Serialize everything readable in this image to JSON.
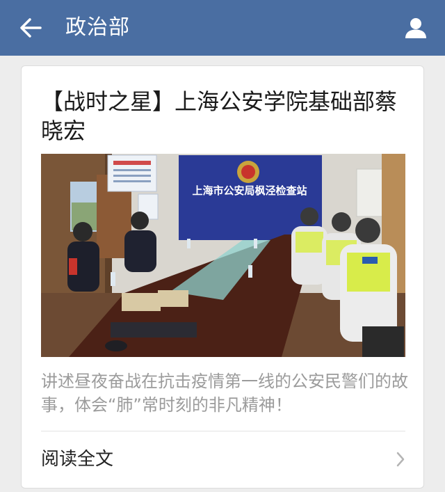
{
  "header": {
    "title": "政治部",
    "back_icon": "arrow-left-icon",
    "user_icon": "user-icon",
    "background_color": "#4a6ea2"
  },
  "card": {
    "title": "【战时之星】上海公安学院基础部蔡晓宏",
    "photo": {
      "sign_text": "上海市公安局枫泾检查站"
    },
    "description": "讲述昼夜奋战在抗击疫情第一线的公安民警们的故事，体会“肺”常时刻的非凡精神！",
    "read_more_label": "阅读全文",
    "chevron_icon": "chevron-right-icon"
  }
}
